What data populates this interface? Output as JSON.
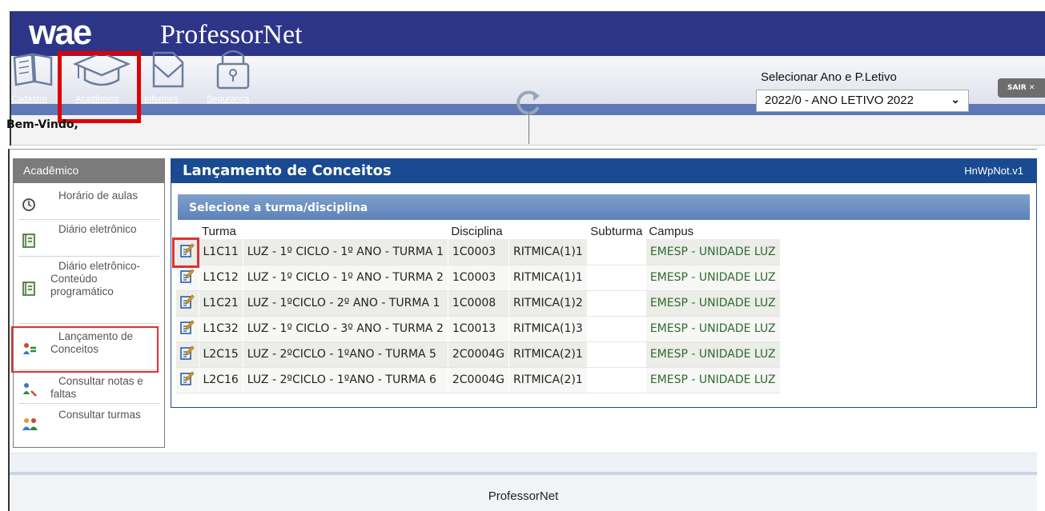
{
  "header": {
    "logo_text": "wae",
    "app_name": "ProfessorNet",
    "welcome": "Bem-Vindo,",
    "year_label": "Selecionar Ano e P.Letivo",
    "year_value": "2022/0 - ANO LETIVO 2022",
    "exit_label": "SAIR ✕"
  },
  "toolbar": [
    {
      "label": "Cadastro",
      "icon": "book-icon"
    },
    {
      "label": "Acadêmico",
      "icon": "graduation-cap-icon"
    },
    {
      "label": "Informes",
      "icon": "envelope-icon"
    },
    {
      "label": "Segurança",
      "icon": "lock-icon"
    }
  ],
  "sidebar": {
    "title": "Acadêmico",
    "items": [
      {
        "label": "Horário de aulas",
        "icon": "clock-icon"
      },
      {
        "label": "Diário eletrônico",
        "icon": "notebook-icon"
      },
      {
        "label": "Diário eletrônico-Conteúdo programático",
        "icon": "notebook-icon"
      },
      {
        "label": "Lançamento de Conceitos",
        "icon": "grades-icon"
      },
      {
        "label": "Consultar notas e faltas",
        "icon": "search-grades-icon"
      },
      {
        "label": "Consultar turmas",
        "icon": "group-icon"
      }
    ]
  },
  "panel": {
    "title": "Lançamento de Conceitos",
    "code": "HnWpNot.v1",
    "selector_title": "Selecione a turma/disciplina"
  },
  "table": {
    "headers": [
      "Turma",
      "Disciplina",
      "Subturma",
      "Campus"
    ],
    "rows": [
      {
        "turma": "L1C11",
        "turma_nome": "LUZ - 1º CICLO - 1º ANO - TURMA 1",
        "disciplina": "1C0003",
        "disciplina_nome": "RITMICA(1)1",
        "subturma": "",
        "campus": "EMESP - UNIDADE LUZ"
      },
      {
        "turma": "L1C12",
        "turma_nome": "LUZ - 1º CICLO - 1º ANO - TURMA 2",
        "disciplina": "1C0003",
        "disciplina_nome": "RITMICA(1)1",
        "subturma": "",
        "campus": "EMESP - UNIDADE LUZ"
      },
      {
        "turma": "L1C21",
        "turma_nome": "LUZ - 1ºCICLO - 2º ANO - TURMA 1",
        "disciplina": "1C0008",
        "disciplina_nome": "RITMICA(1)2",
        "subturma": "",
        "campus": "EMESP - UNIDADE LUZ"
      },
      {
        "turma": "L1C32",
        "turma_nome": "LUZ - 1º CICLO - 3º ANO - TURMA 2",
        "disciplina": "1C0013",
        "disciplina_nome": "RITMICA(1)3",
        "subturma": "",
        "campus": "EMESP - UNIDADE LUZ"
      },
      {
        "turma": "L2C15",
        "turma_nome": "LUZ - 2ºCICLO - 1ºANO - TURMA 5",
        "disciplina": "2C0004G",
        "disciplina_nome": "RITMICA(2)1",
        "subturma": "",
        "campus": "EMESP - UNIDADE LUZ"
      },
      {
        "turma": "L2C16",
        "turma_nome": "LUZ - 2ºCICLO - 1ºANO - TURMA 6",
        "disciplina": "2C0004G",
        "disciplina_nome": "RITMICA(2)1",
        "subturma": "",
        "campus": "EMESP - UNIDADE LUZ"
      }
    ]
  },
  "footer": {
    "text": "ProfessorNet"
  },
  "colors": {
    "brand": "#2d3589",
    "panel": "#1a4a91",
    "highlight": "#e00000",
    "campus": "#2e6b2e"
  }
}
